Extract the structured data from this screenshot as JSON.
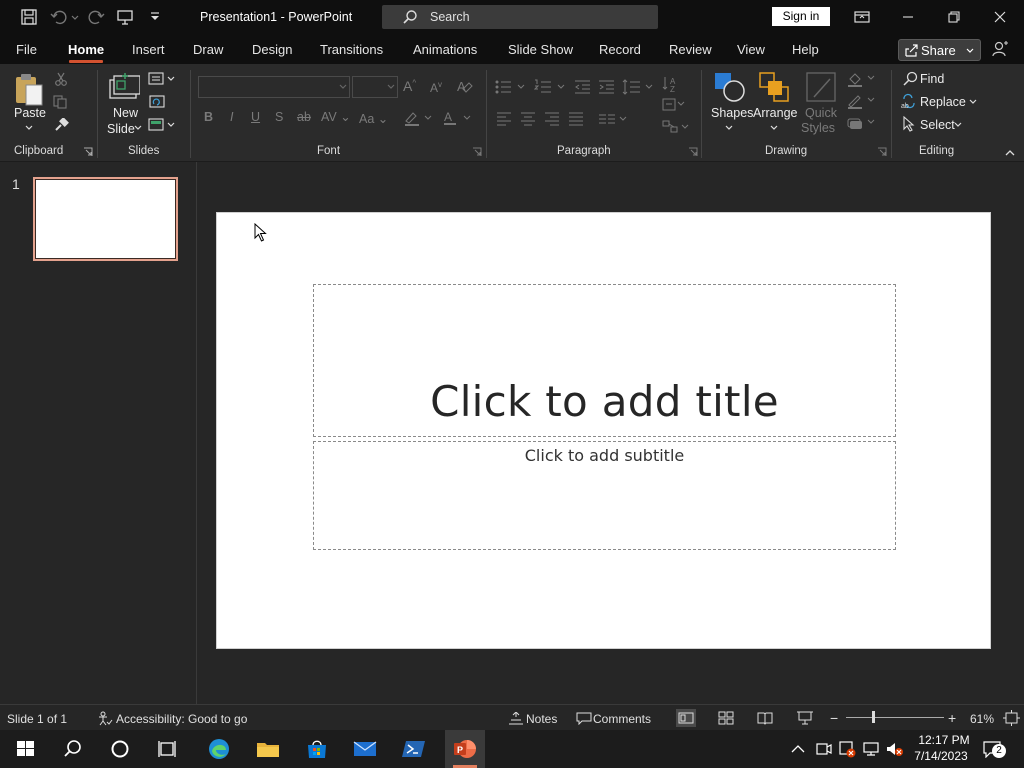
{
  "app": {
    "document_title": "Presentation1  -  PowerPoint",
    "search_label": "Search",
    "sign_in_label": "Sign in"
  },
  "tabs": [
    {
      "label": "File"
    },
    {
      "label": "Home",
      "active": true
    },
    {
      "label": "Insert"
    },
    {
      "label": "Draw"
    },
    {
      "label": "Design"
    },
    {
      "label": "Transitions"
    },
    {
      "label": "Animations"
    },
    {
      "label": "Slide Show"
    },
    {
      "label": "Record"
    },
    {
      "label": "Review"
    },
    {
      "label": "View"
    },
    {
      "label": "Help"
    }
  ],
  "share_label": "Share",
  "ribbon": {
    "clipboard": {
      "paste_label": "Paste",
      "group_label": "Clipboard"
    },
    "slides": {
      "new_slide_line1": "New",
      "new_slide_line2": "Slide",
      "group_label": "Slides"
    },
    "font": {
      "group_label": "Font"
    },
    "paragraph": {
      "group_label": "Paragraph"
    },
    "drawing": {
      "shapes_label": "Shapes",
      "arrange_label": "Arrange",
      "quick_styles_line1": "Quick",
      "quick_styles_line2": "Styles",
      "group_label": "Drawing"
    },
    "editing": {
      "find_label": "Find",
      "replace_label": "Replace",
      "select_label": "Select",
      "group_label": "Editing"
    }
  },
  "thumbnails": [
    {
      "number": "1"
    }
  ],
  "slide": {
    "title_placeholder": "Click to add title",
    "subtitle_placeholder": "Click to add subtitle"
  },
  "status": {
    "slide_info": "Slide 1 of 1",
    "accessibility": "Accessibility: Good to go",
    "notes_label": "Notes",
    "comments_label": "Comments",
    "zoom_minus": "−",
    "zoom_plus": "+",
    "zoom_level": "61%",
    "zoom_fraction": 0.61
  },
  "taskbar": {
    "time": "12:17 PM",
    "date": "7/14/2023",
    "notification_count": "2"
  },
  "colors": {
    "accent": "#d35230",
    "thumb_border": "#e4a28e"
  }
}
